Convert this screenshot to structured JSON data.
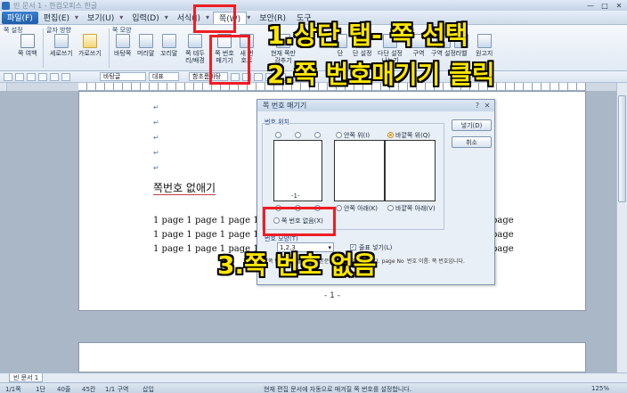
{
  "window": {
    "title": "빈 문서 1 - 한컴오피스 한글"
  },
  "menu": {
    "file": "파일(F)",
    "items": [
      "편집(E)",
      "보기(U)",
      "입력(D)",
      "서식(J)",
      "쪽(W)",
      "보안(R)",
      "도구"
    ],
    "active": "쪽(W)"
  },
  "ribbon": {
    "groups": [
      "쪽 설정",
      "글자 방향",
      "쪽 모양"
    ],
    "buttons": {
      "page_setup": "쪽 여백",
      "vertical": "세로쓰기",
      "horizontal": "가로쓰기",
      "background": "바탕쪽",
      "header": "머리말",
      "footer": "꼬리말",
      "border": "쪽 테두리/배경",
      "hide_page_number": "쪽 번호 매기기",
      "new_number": "새 번호로",
      "current_hide": "현재 쪽만 감추기",
      "col": "단",
      "col2": "단 설정",
      "col3": "다단 설정 나누기",
      "col4": "구역",
      "col5": "구역 설정",
      "label": "라벨",
      "manuscript": "원고지"
    }
  },
  "toolbar": {
    "style": "바탕글",
    "lang": "대표",
    "font": "함초롬바탕"
  },
  "document": {
    "heading": "쪽번호 없애기",
    "lines": [
      "1 page 1 page 1 page 1",
      "1 page 1 page 1 page 1",
      "1 page 1 page 1 page 1"
    ],
    "overflow": "page",
    "page_number": "- 1 -"
  },
  "dialog": {
    "title": "쪽 번호 매기기",
    "section": "번호 위치",
    "options": {
      "inner_top": "안쪽 위(I)",
      "outer_top": "바깥쪽 위(Q)",
      "inner_bottom": "안쪽 아래(K)",
      "outer_bottom": "바깥쪽 아래(V)",
      "none": "쪽 번호 없음(X)"
    },
    "preview_number": "-1-",
    "buttons": {
      "ok": "넣기(D)",
      "cancel": "취소"
    },
    "shape_section": "번호 모양(T)",
    "shape_value": "1,2,3",
    "checkbox_label": "줄표 넣기(L)",
    "desc_left": "쪽 번호 위치를 문서의 본문 위쪽에 만들어 봅니다. page No",
    "desc_right": "번호 이름: 쪽 번호입니다."
  },
  "status": {
    "tab": "빈 문서 1",
    "items": [
      "1/1쪽",
      "1단",
      "40줄",
      "45칸",
      "1/1 구역",
      "삽입"
    ],
    "message": "현재 편집 문서에 자동으로 매겨질 쪽 번호를 설정합니다.",
    "zoom": "125%"
  },
  "annotations": {
    "step1": "1.상단 탭- 쪽 선택",
    "step2": "2.쪽 번호매기기 클릭",
    "step3": "3.쪽 번호 없음"
  },
  "colors": {
    "highlight": "#ef1d24",
    "annotation_text": "#ffe600",
    "accent": "#1f5ea8"
  }
}
